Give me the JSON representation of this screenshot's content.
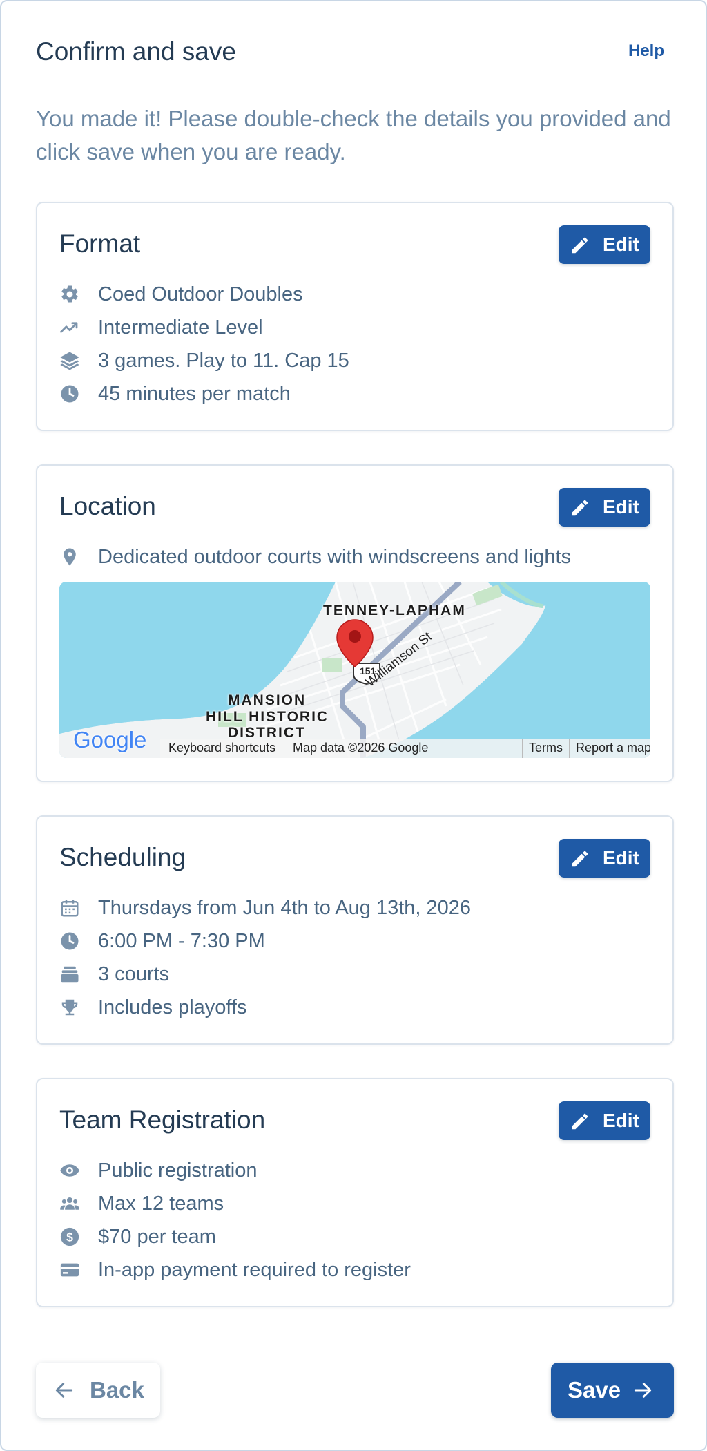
{
  "header": {
    "title": "Confirm and save",
    "help_label": "Help"
  },
  "intro": "You made it! Please double-check the details you provided and click save when you are ready.",
  "edit_label": "Edit",
  "format": {
    "title": "Format",
    "rows": [
      {
        "icon": "gear-icon",
        "text": "Coed Outdoor Doubles"
      },
      {
        "icon": "trending-up-icon",
        "text": "Intermediate Level"
      },
      {
        "icon": "layers-icon",
        "text": "3 games. Play to 11. Cap 15"
      },
      {
        "icon": "clock-icon",
        "text": "45 minutes per match"
      }
    ]
  },
  "location": {
    "title": "Location",
    "rows": [
      {
        "icon": "map-pin-icon",
        "text": "Dedicated outdoor courts with windscreens and lights"
      }
    ],
    "map": {
      "labels": {
        "neighborhood_1": "TENNEY-LAPHAM",
        "neighborhood_2_line1": "MANSION",
        "neighborhood_2_line2": "HILL HISTORIC",
        "neighborhood_2_line3": "DISTRICT",
        "street": "Williamson St",
        "route": "151"
      },
      "logo": "Google",
      "attribution": {
        "shortcuts": "Keyboard shortcuts",
        "data": "Map data ©2026 Google",
        "terms": "Terms",
        "report": "Report a map error"
      }
    }
  },
  "scheduling": {
    "title": "Scheduling",
    "rows": [
      {
        "icon": "calendar-icon",
        "text": "Thursdays from Jun 4th to Aug 13th, 2026"
      },
      {
        "icon": "clock-icon",
        "text": "6:00 PM - 7:30 PM"
      },
      {
        "icon": "courts-icon",
        "text": "3 courts"
      },
      {
        "icon": "trophy-icon",
        "text": "Includes playoffs"
      }
    ]
  },
  "registration": {
    "title": "Team Registration",
    "rows": [
      {
        "icon": "eye-icon",
        "text": "Public registration"
      },
      {
        "icon": "users-icon",
        "text": "Max 12 teams"
      },
      {
        "icon": "dollar-icon",
        "text": "$70 per team"
      },
      {
        "icon": "credit-card-icon",
        "text": "In-app payment required to register"
      }
    ]
  },
  "footer": {
    "back_label": "Back",
    "save_label": "Save"
  },
  "colors": {
    "primary": "#1f5aa6",
    "heading": "#243b53",
    "body_text": "#486581",
    "muted": "#6b87a3",
    "icon": "#7b93ab",
    "water": "#8fd7ec",
    "pin": "#e53935"
  }
}
